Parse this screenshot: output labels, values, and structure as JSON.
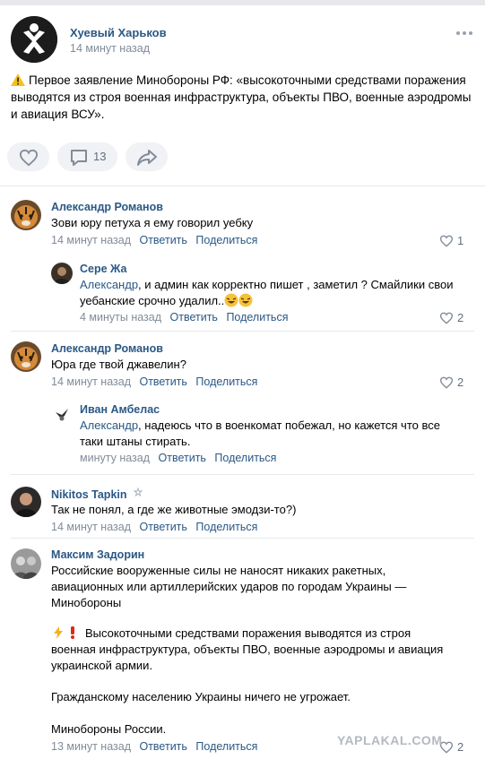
{
  "post": {
    "author": "Хуевый Харьков",
    "time": "14 минут назад",
    "text": "Первое заявление Минобороны РФ: «высокоточными средствами поражения выводятся из строя военная инфраструктура, объекты ПВО, военные аэродромы и авиация ВСУ».",
    "comments_count": "13",
    "icons": {
      "warning": "warning-icon",
      "more": "more-icon",
      "like": "heart-icon",
      "comment": "comment-icon",
      "share": "share-icon"
    }
  },
  "comments": [
    {
      "author": "Александр Романов",
      "text": "Зови юру петуха я ему говорил уебку",
      "time": "14 минут назад",
      "reply_label": "Ответить",
      "share_label": "Поделиться",
      "likes": "1"
    },
    {
      "author": "Сере Жа",
      "mention": "Александр",
      "text": ", и админ как корректно пишет , заметил ? Смайлики свои уебанские срочно удалил..",
      "time": "4 минуты назад",
      "reply_label": "Ответить",
      "share_label": "Поделиться",
      "likes": "2",
      "emoji": "laughing-emoji-icon"
    },
    {
      "author": "Александр Романов",
      "text": "Юра где твой джавелин?",
      "time": "14 минут назад",
      "reply_label": "Ответить",
      "share_label": "Поделиться",
      "likes": "2"
    },
    {
      "author": "Иван Амбелас",
      "mention": "Александр",
      "text": ", надеюсь что в военкомат побежал, но кажется что все таки штаны стирать.",
      "time": "минуту назад",
      "reply_label": "Ответить",
      "share_label": "Поделиться"
    },
    {
      "author": "Nikitos Tapkin",
      "text": "Так не понял, а где же животные эмодзи-то?)",
      "time": "14 минут назад",
      "reply_label": "Ответить",
      "share_label": "Поделиться"
    },
    {
      "author": "Максим Задорин",
      "text_p1": "Российские вооруженные силы не наносят никаких ракетных, авиационных или артиллерийских ударов по городам Украины — Минобороны",
      "text_p2": "Высокоточными средствами поражения выводятся из строя военная инфраструктура, объекты ПВО, военные аэродромы и авиация украинской армии.",
      "text_p3": "Гражданскому населению Украины ничего не угрожает.",
      "text_p4": "Минобороны России.",
      "time": "13 минут назад",
      "reply_label": "Ответить",
      "share_label": "Поделиться",
      "likes": "2"
    }
  ],
  "watermark": "YAPLAKAL.COM",
  "colors": {
    "link": "#2a5885",
    "meta": "#818c99",
    "pill_bg": "#f0f2f5",
    "divider": "#e7e8ec"
  }
}
